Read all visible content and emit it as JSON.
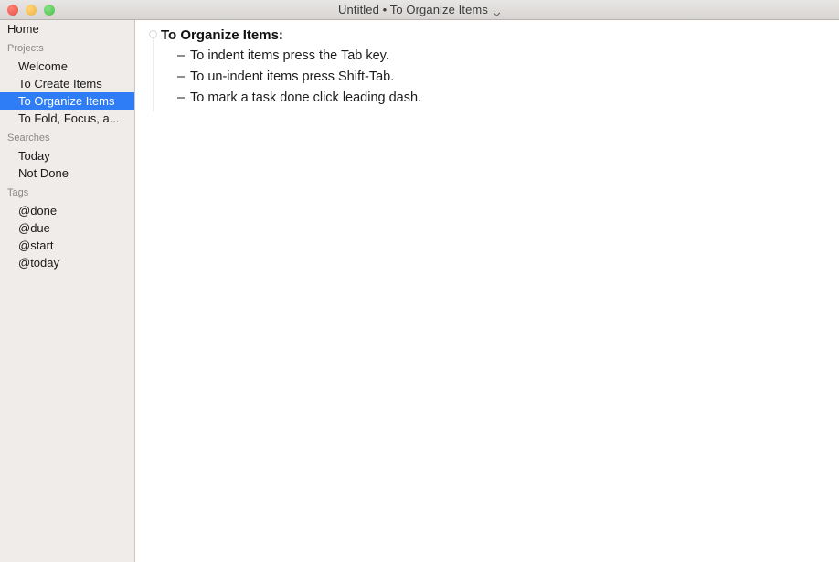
{
  "window": {
    "title": "Untitled • To Organize Items",
    "title_chevron_icon": "chevron-down-icon",
    "traffic_lights": {
      "close_label": "Close",
      "minimize_label": "Minimize",
      "zoom_label": "Zoom"
    },
    "accent_color": "#2f7df6",
    "sidebar_bg": "#efecea",
    "content_bg": "#ffffff"
  },
  "sidebar": {
    "home": {
      "label": "Home"
    },
    "sections": [
      {
        "header": "Projects",
        "items": [
          {
            "label": "Welcome",
            "selected": false
          },
          {
            "label": "To Create Items",
            "selected": false
          },
          {
            "label": "To Organize Items",
            "selected": true
          },
          {
            "label": "To Fold, Focus, a...",
            "selected": false
          }
        ]
      },
      {
        "header": "Searches",
        "items": [
          {
            "label": "Today",
            "selected": false
          },
          {
            "label": "Not Done",
            "selected": false
          }
        ]
      },
      {
        "header": "Tags",
        "items": [
          {
            "label": "@done",
            "selected": false
          },
          {
            "label": "@due",
            "selected": false
          },
          {
            "label": "@start",
            "selected": false
          },
          {
            "label": "@today",
            "selected": false
          }
        ]
      }
    ]
  },
  "document": {
    "fold_handle_icon": "fold-circle-icon",
    "heading": "To Organize Items:",
    "items": [
      {
        "dash": "–",
        "text": "To indent items press the Tab key."
      },
      {
        "dash": "–",
        "text": "To un-indent items press Shift-Tab."
      },
      {
        "dash": "–",
        "text": "To mark a task done click leading dash."
      }
    ]
  }
}
